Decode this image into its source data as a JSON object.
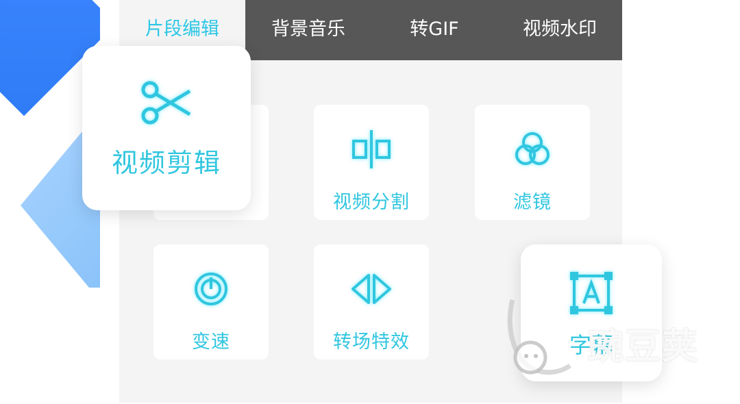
{
  "tabs": [
    {
      "label": "片段编辑",
      "active": true
    },
    {
      "label": "背景音乐",
      "active": false
    },
    {
      "label": "转GIF",
      "active": false
    },
    {
      "label": "视频水印",
      "active": false
    }
  ],
  "feature_main": {
    "label": "视频剪辑",
    "icon": "scissors-icon"
  },
  "cards": [
    {
      "label": "视频分割",
      "icon": "split-icon"
    },
    {
      "label": "滤镜",
      "icon": "filter-icon"
    },
    {
      "label": "变速",
      "icon": "speedometer-icon"
    },
    {
      "label": "转场特效",
      "icon": "transition-icon"
    }
  ],
  "feature_subtitle": {
    "label": "字幕",
    "icon": "text-box-icon"
  },
  "watermark": {
    "text": "豌豆荚"
  },
  "colors": {
    "accent": "#30c6df",
    "tabbar": "#575757",
    "panel": "#f4f4f4",
    "brand_blue": "#2f7cf6"
  }
}
